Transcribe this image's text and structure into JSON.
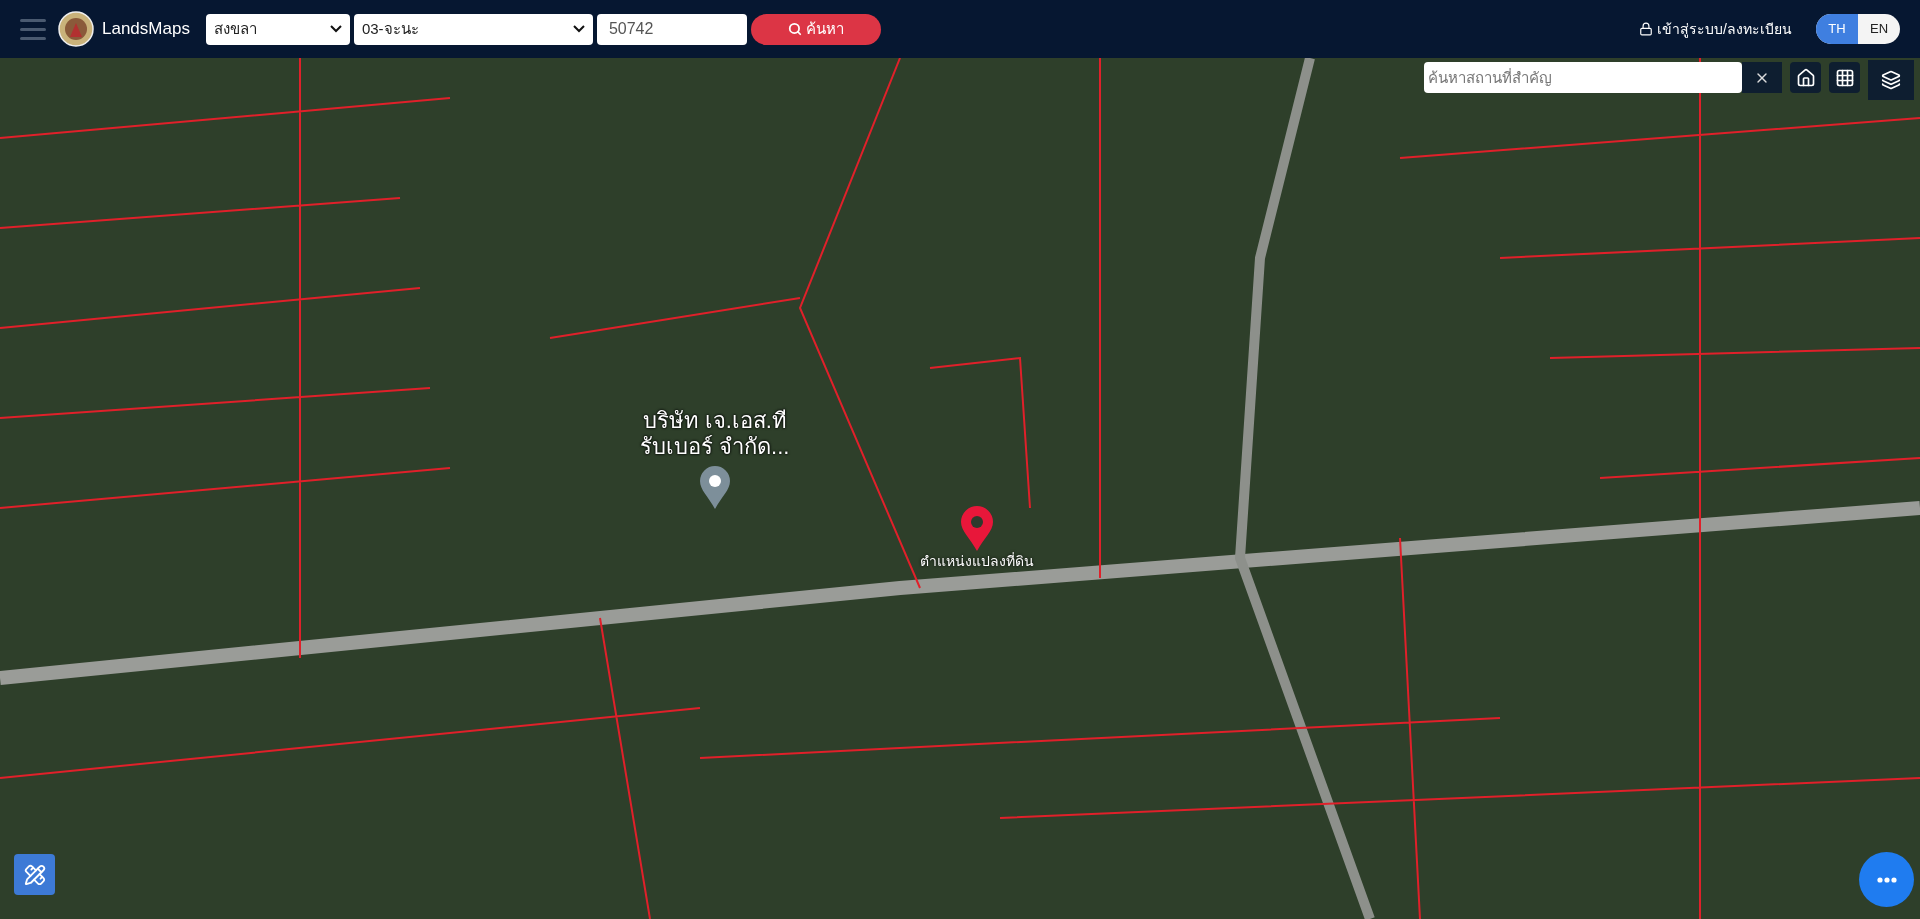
{
  "header": {
    "brand": "LandsMaps",
    "province": {
      "value": "สงขลา"
    },
    "district": {
      "value": "03-จะนะ"
    },
    "parcel_number": {
      "value": "50742"
    },
    "search_button": "ค้นหา",
    "login_link": "เข้าสู่ระบบ/ลงทะเบียน",
    "languages": [
      {
        "label": "TH",
        "selected": true
      },
      {
        "label": "EN",
        "selected": false
      }
    ]
  },
  "map": {
    "place_search": {
      "placeholder": "ค้นหาสถานที่สำคัญ"
    },
    "markers": [
      {
        "kind": "place",
        "lines": [
          "บริษัท เจ.เอส.ที",
          "รับเบอร์ จำกัด..."
        ]
      },
      {
        "kind": "parcel",
        "lines": [
          "ตำแหน่งแปลงที่ดิน"
        ]
      }
    ]
  }
}
